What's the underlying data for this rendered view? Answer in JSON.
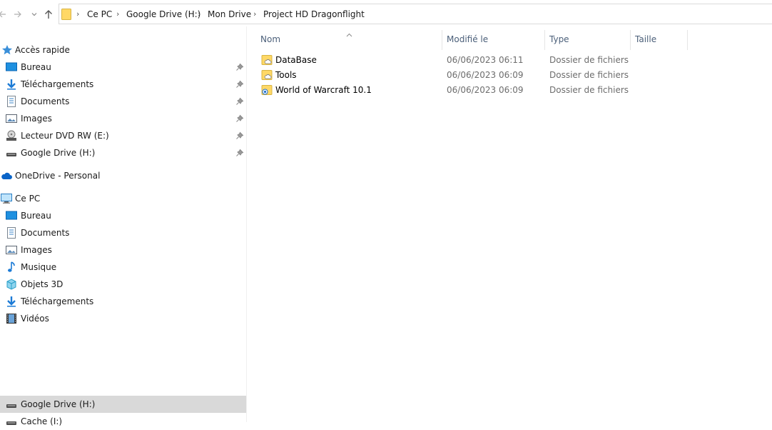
{
  "breadcrumb": [
    "Ce PC",
    "Google Drive (H:)",
    "Mon Drive",
    "Project HD Dragonflight"
  ],
  "nav": {
    "quick_access": "Accès rapide",
    "quick_items": [
      "Bureau",
      "Téléchargements",
      "Documents",
      "Images",
      "Lecteur DVD RW (E:)",
      "Google Drive (H:)"
    ],
    "onedrive": "OneDrive - Personal",
    "this_pc": "Ce PC",
    "pc_items": [
      "Bureau",
      "Documents",
      "Images",
      "Musique",
      "Objets 3D",
      "Téléchargements",
      "Vidéos"
    ],
    "selected_drive": "Google Drive (H:)",
    "cache_drive": "Cache (I:)"
  },
  "columns": {
    "name": "Nom",
    "modified": "Modifié le",
    "type": "Type",
    "size": "Taille"
  },
  "files": [
    {
      "name": "DataBase",
      "modified": "06/06/2023 06:11",
      "type": "Dossier de fichiers",
      "icon": "cloud-folder"
    },
    {
      "name": "Tools",
      "modified": "06/06/2023 06:09",
      "type": "Dossier de fichiers",
      "icon": "cloud-folder"
    },
    {
      "name": "World of Warcraft 10.1",
      "modified": "06/06/2023 06:09",
      "type": "Dossier de fichiers",
      "icon": "sync-folder"
    }
  ],
  "colors": {
    "folder": "#ffd866",
    "accent": "#0078d7",
    "selected": "#d9d9d9"
  }
}
